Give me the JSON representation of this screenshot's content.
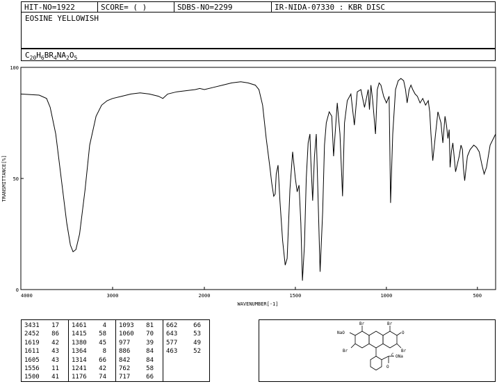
{
  "header": {
    "hit_no": "HIT-NO=1922",
    "score": "SCORE=  (    )",
    "sdbs_no": "SDBS-NO=2299",
    "method": "IR-NIDA-07330 : KBR DISC"
  },
  "compound": {
    "name": "EOSINE YELLOWISH",
    "formula_parts": [
      {
        "t": "C",
        "sub": false
      },
      {
        "t": "20",
        "sub": true
      },
      {
        "t": "H",
        "sub": false
      },
      {
        "t": "6",
        "sub": true
      },
      {
        "t": "BR",
        "sub": false
      },
      {
        "t": "4",
        "sub": true
      },
      {
        "t": "NA",
        "sub": false
      },
      {
        "t": "2",
        "sub": true
      },
      {
        "t": "O",
        "sub": false
      },
      {
        "t": "5",
        "sub": true
      }
    ]
  },
  "chart_data": {
    "type": "line",
    "xlabel": "WAVENUMBER[-1]",
    "ylabel": "TRANSMITTANCE[%]",
    "x_ticks": [
      4000,
      3000,
      2000,
      1500,
      1000,
      500
    ],
    "y_ticks": [
      0,
      50,
      100
    ],
    "xlim": [
      4000,
      400
    ],
    "ylim": [
      0,
      100
    ],
    "x_scale": "split-linear-at-2000",
    "series": [
      {
        "x": [
          4000,
          3800,
          3720,
          3680,
          3620,
          3560,
          3500,
          3460,
          3431,
          3400,
          3360,
          3300,
          3250,
          3180,
          3120,
          3060,
          3000,
          2900,
          2800,
          2700,
          2600,
          2500,
          2452,
          2400,
          2300,
          2200,
          2100,
          2050,
          2000,
          1950,
          1900,
          1850,
          1800,
          1760,
          1720,
          1700,
          1680,
          1660,
          1640,
          1630,
          1619,
          1611,
          1605,
          1595,
          1585,
          1570,
          1556,
          1545,
          1530,
          1515,
          1500,
          1490,
          1480,
          1470,
          1461,
          1450,
          1440,
          1430,
          1420,
          1415,
          1405,
          1395,
          1385,
          1375,
          1364,
          1350,
          1340,
          1330,
          1314,
          1300,
          1290,
          1270,
          1255,
          1241,
          1230,
          1215,
          1195,
          1176,
          1160,
          1140,
          1120,
          1110,
          1100,
          1093,
          1085,
          1075,
          1060,
          1050,
          1040,
          1030,
          1015,
          1000,
          985,
          977,
          965,
          950,
          935,
          920,
          905,
          895,
          886,
          875,
          865,
          855,
          842,
          830,
          815,
          800,
          785,
          770,
          762,
          755,
          745,
          730,
          717,
          700,
          690,
          678,
          670,
          662,
          655,
          650,
          643,
          635,
          620,
          600,
          590,
          582,
          577,
          570,
          555,
          540,
          520,
          505,
          490,
          475,
          463,
          450,
          440,
          430,
          400
        ],
        "y": [
          88,
          87.5,
          86,
          82,
          70,
          50,
          30,
          20,
          17,
          18,
          25,
          45,
          65,
          78,
          83,
          85,
          86,
          87,
          88,
          88.5,
          88,
          87,
          86,
          88,
          89,
          89.5,
          90,
          90.5,
          90,
          91,
          92,
          93,
          93.5,
          93,
          92,
          90,
          83,
          68,
          55,
          48,
          42,
          43,
          52,
          56,
          40,
          22,
          11,
          14,
          45,
          62,
          50,
          44,
          47,
          30,
          4,
          20,
          50,
          66,
          70,
          58,
          40,
          60,
          70,
          40,
          8,
          35,
          65,
          75,
          80,
          78,
          60,
          84,
          70,
          42,
          75,
          85,
          88,
          74,
          89,
          90,
          82,
          86,
          90,
          81,
          92,
          85,
          70,
          90,
          93,
          92,
          87,
          84,
          87,
          39,
          70,
          90,
          94,
          95,
          94,
          90,
          84,
          90,
          92,
          90,
          88,
          87,
          84,
          86,
          83,
          85,
          80,
          70,
          58,
          70,
          80,
          75,
          66,
          78,
          74,
          68,
          72,
          55,
          62,
          66,
          53,
          60,
          65,
          63,
          55,
          49,
          60,
          63,
          65,
          64,
          62,
          56,
          52,
          55,
          60,
          65,
          70
        ]
      }
    ]
  },
  "peaks": {
    "columns": [
      [
        [
          "3431",
          "17"
        ],
        [
          "2452",
          "86"
        ],
        [
          "1619",
          "42"
        ],
        [
          "1611",
          "43"
        ],
        [
          "1605",
          "43"
        ],
        [
          "1556",
          "11"
        ],
        [
          "1500",
          "41"
        ]
      ],
      [
        [
          "1461",
          "4"
        ],
        [
          "1415",
          "58"
        ],
        [
          "1380",
          "45"
        ],
        [
          "1364",
          "8"
        ],
        [
          "1314",
          "66"
        ],
        [
          "1241",
          "42"
        ],
        [
          "1176",
          "74"
        ]
      ],
      [
        [
          "1093",
          "81"
        ],
        [
          "1060",
          "70"
        ],
        [
          "977",
          "39"
        ],
        [
          "886",
          "84"
        ],
        [
          "842",
          "84"
        ],
        [
          "762",
          "58"
        ],
        [
          "717",
          "66"
        ]
      ],
      [
        [
          "662",
          "66"
        ],
        [
          "643",
          "53"
        ],
        [
          "577",
          "49"
        ],
        [
          "463",
          "52"
        ]
      ]
    ]
  },
  "structure": {
    "labels": [
      "NaO",
      "Br",
      "Br",
      "O",
      "Br",
      "Br",
      "C",
      "ONa",
      "O"
    ]
  }
}
